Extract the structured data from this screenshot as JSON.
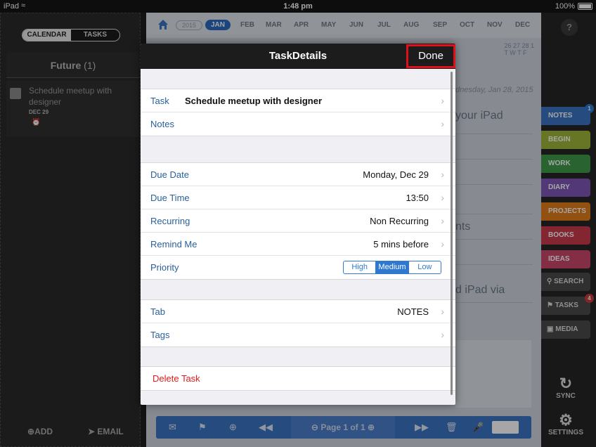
{
  "statusbar": {
    "device": "iPad",
    "time": "1:48 pm",
    "battery": "100%"
  },
  "left": {
    "toggle_calendar": "CALENDAR",
    "toggle_tasks": "TASKS",
    "future_label": "Future",
    "future_count": "(1)",
    "task": {
      "title": "Schedule meetup with designer",
      "date": "DEC 29"
    },
    "add_label": "ADD",
    "email_label": "EMAIL"
  },
  "main": {
    "year": "2015",
    "months": [
      "JAN",
      "FEB",
      "MAR",
      "APR",
      "MAY",
      "JUN",
      "JUL",
      "AUG",
      "SEP",
      "OCT",
      "NOV",
      "DEC"
    ],
    "active_month": "JAN",
    "cal_days": "26 27 28 1",
    "cal_weekdays": "T W T F",
    "note_date": "dnesday, Jan 28, 2015",
    "note_lines": [
      "your iPad",
      "nts",
      "d iPad via"
    ],
    "page_label": "Page 1 of 1"
  },
  "right": {
    "help": "?",
    "tabs": [
      {
        "label": "NOTES",
        "color": "#3b74c4",
        "badge": "1"
      },
      {
        "label": "BEGIN",
        "color": "#9fb53a"
      },
      {
        "label": "WORK",
        "color": "#3f9a4a"
      },
      {
        "label": "DIARY",
        "color": "#7f56b5"
      },
      {
        "label": "PROJECTS",
        "color": "#e07d1a"
      },
      {
        "label": "BOOKS",
        "color": "#c93b4e"
      },
      {
        "label": "IDEAS",
        "color": "#c9486b"
      }
    ],
    "tools": [
      {
        "label": "SEARCH"
      },
      {
        "label": "TASKS",
        "badge": "4"
      },
      {
        "label": "MEDIA"
      }
    ],
    "sync_label": "SYNC",
    "settings_label": "SETTINGS"
  },
  "modal": {
    "title": "TaskDetails",
    "done_label": "Done",
    "task_label": "Task",
    "task_value": "Schedule meetup with designer",
    "notes_label": "Notes",
    "due_date_label": "Due Date",
    "due_date_value": "Monday, Dec 29",
    "due_time_label": "Due Time",
    "due_time_value": "13:50",
    "recurring_label": "Recurring",
    "recurring_value": "Non Recurring",
    "remind_label": "Remind Me",
    "remind_value": "5 mins before",
    "priority_label": "Priority",
    "priority_options": [
      "High",
      "Medium",
      "Low"
    ],
    "priority_selected": "Medium",
    "tab_label": "Tab",
    "tab_value": "NOTES",
    "tags_label": "Tags",
    "delete_label": "Delete Task"
  },
  "colors": {
    "accent_blue": "#2f78d0",
    "delete_red": "#e01a1a",
    "done_outline": "#e0101a"
  }
}
